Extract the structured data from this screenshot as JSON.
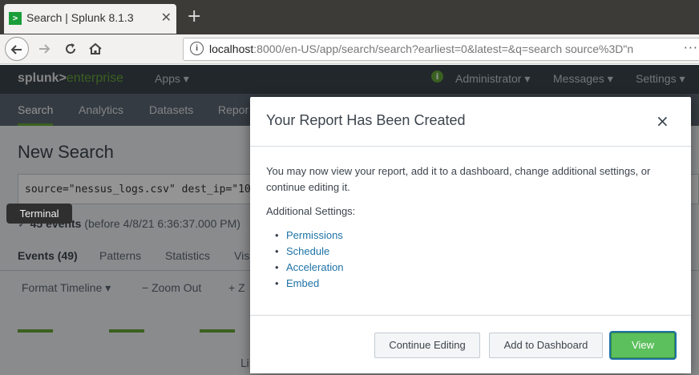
{
  "browser": {
    "tab_title": "Search | Splunk 8.1.3",
    "favicon": ">",
    "tab_close": "✕",
    "new_tab": "+",
    "url_host": "localhost",
    "url_rest": ":8000/en-US/app/search/search?earliest=0&latest=&q=search source%3D\"n",
    "url_menu": "···"
  },
  "splunk": {
    "logo_main": "splunk>",
    "logo_sub": "enterprise",
    "apps_menu": "Apps ▾",
    "user_menu": "Administrator ▾",
    "messages_menu": "Messages ▾",
    "settings_menu": "Settings ▾",
    "health_icon_glyph": "i",
    "app_nav": [
      "Search",
      "Analytics",
      "Datasets",
      "Repor"
    ],
    "page_title": "New Search",
    "search_query": "source=\"nessus_logs.csv\" dest_ip=\"10.11.",
    "events_count_prefix": "45 events",
    "events_count_suffix": "(before 4/8/21 6:36:37.000 PM)",
    "sub_tabs": [
      "Events (49)",
      "Patterns",
      "Statistics",
      "Vis"
    ],
    "format_timeline": "Format Timeline ▾",
    "zoom_out": "− Zoom Out",
    "zoom_sel": "+ Z",
    "bottom_fragment": "Li"
  },
  "tooltip": {
    "text": "Terminal"
  },
  "modal": {
    "title": "Your Report Has Been Created",
    "close": "×",
    "message": "You may now view your report, add it to a dashboard, change additional settings, or continue editing it.",
    "settings_label": "Additional Settings:",
    "settings_links": [
      "Permissions",
      "Schedule",
      "Acceleration",
      "Embed"
    ],
    "buttons": {
      "continue": "Continue Editing",
      "dashboard": "Add to Dashboard",
      "view": "View"
    }
  },
  "colors": {
    "accent_green": "#65a637",
    "link_blue": "#1e73a6",
    "primary_button": "#5cc05c"
  }
}
